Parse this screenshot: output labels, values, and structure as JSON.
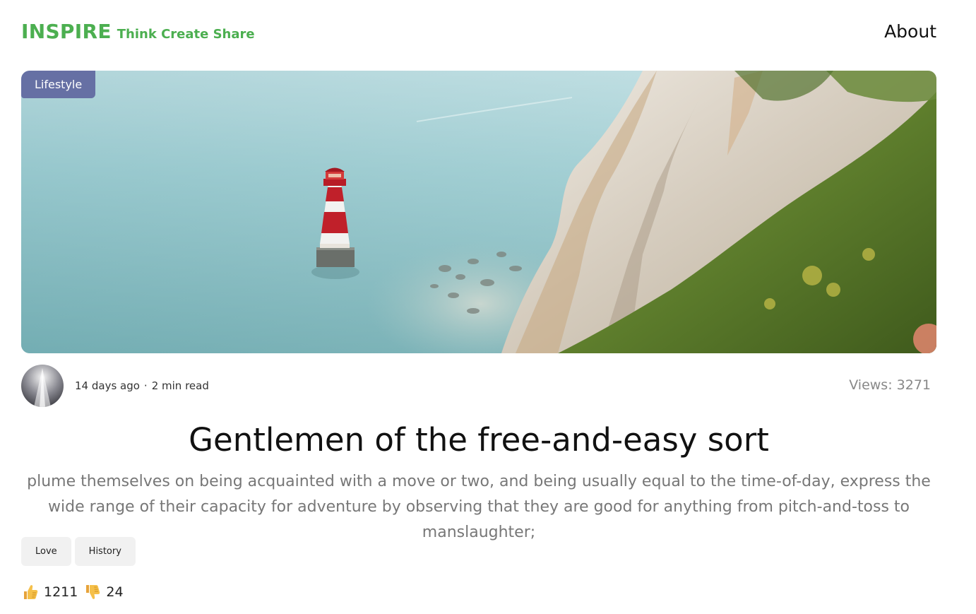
{
  "header": {
    "brand_name": "INSPIRE",
    "brand_tagline": "Think Create Share",
    "nav_about": "About"
  },
  "post": {
    "category": "Lifestyle",
    "image_icon": "lighthouse-cliff-photo",
    "avatar_icon": "author-avatar",
    "published": "14 days ago",
    "separator": "·",
    "read_time": "2 min read",
    "views": "Views: 3271",
    "title": "Gentlemen of the free-and-easy sort",
    "excerpt": "plume themselves on being acquainted with a move or two, and being usually equal to the time-of-day, express the wide range of their capacity for adventure by observing that they are good for anything from pitch-and-toss to manslaughter;",
    "tags": [
      "Love",
      "History"
    ],
    "likes": "1211",
    "dislikes": "24"
  },
  "colors": {
    "brand": "#4caf50",
    "badge": "#6670a4",
    "muted": "#777777",
    "tag_bg": "#f1f1f1"
  }
}
